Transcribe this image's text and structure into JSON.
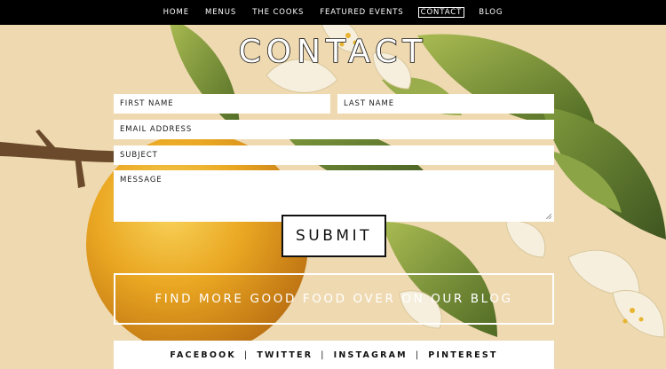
{
  "nav": {
    "items": [
      {
        "label": "HOME"
      },
      {
        "label": "MENUS"
      },
      {
        "label": "THE COOKS"
      },
      {
        "label": "FEATURED EVENTS"
      },
      {
        "label": "CONTACT"
      },
      {
        "label": "BLOG"
      }
    ],
    "active": "CONTACT"
  },
  "page": {
    "title": "CONTACT"
  },
  "form": {
    "first_name_placeholder": "FIRST NAME",
    "last_name_placeholder": "LAST NAME",
    "email_placeholder": "EMAIL ADDRESS",
    "subject_placeholder": "SUBJECT",
    "message_placeholder": "MESSAGE",
    "submit_label": "SUBMIT"
  },
  "blog_banner": {
    "label": "FIND MORE GOOD FOOD OVER ON OUR BLOG"
  },
  "social": {
    "links": [
      "FACEBOOK",
      "TWITTER",
      "INSTAGRAM",
      "PINTEREST"
    ],
    "separator": "|"
  },
  "colors": {
    "nav_bg": "#000000",
    "page_bg": "#efd9b1",
    "leaf_green": "#6f8a36",
    "orange": "#e8a21c",
    "blossom": "#f3ecd8"
  }
}
